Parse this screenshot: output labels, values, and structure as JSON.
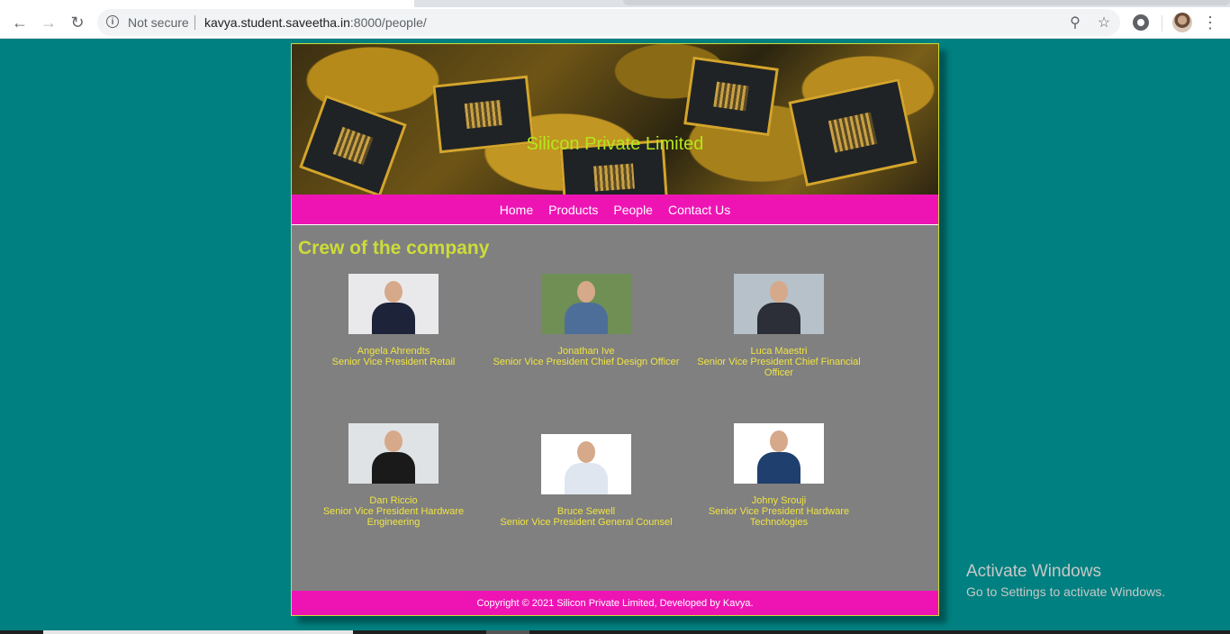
{
  "browser": {
    "security_label": "Not secure",
    "url_host": "kavya.student.saveetha.in",
    "url_rest": ":8000/people/"
  },
  "site": {
    "company_name": "Silicon Private Limited",
    "nav": [
      "Home",
      "Products",
      "People",
      "Contact Us"
    ],
    "heading": "Crew of the company",
    "people": [
      {
        "name": "Angela Ahrendts",
        "title": "Senior Vice President Retail",
        "suit_color": "#1d2338",
        "bg_color": "#e9e9ec"
      },
      {
        "name": "Jonathan Ive",
        "title": "Senior Vice President Chief Design Officer",
        "suit_color": "#4e6e9a",
        "bg_color": "#6f8f55"
      },
      {
        "name": "Luca Maestri",
        "title": "Senior Vice President Chief Financial Officer",
        "suit_color": "#2c2f38",
        "bg_color": "#b7c1c9"
      },
      {
        "name": "Dan Riccio",
        "title": "Senior Vice President Hardware Engineering",
        "suit_color": "#1a1a1a",
        "bg_color": "#dfe3e6"
      },
      {
        "name": "Bruce Sewell",
        "title": "Senior Vice President General Counsel",
        "suit_color": "#dfe6f0",
        "bg_color": "#ffffff"
      },
      {
        "name": "Johny Srouji",
        "title": "Senior Vice President Hardware Technologies",
        "suit_color": "#1f3f6e",
        "bg_color": "#ffffff"
      }
    ],
    "footer": "Copyright © 2021 Silicon Private Limited, Developed by Kavya."
  },
  "os": {
    "activate_title": "Activate Windows",
    "activate_sub": "Go to Settings to activate Windows."
  },
  "icons": [
    "back-arrow-icon",
    "forward-arrow-icon",
    "reload-icon",
    "info-icon",
    "zoom-icon",
    "star-icon",
    "extension-icon",
    "profile-avatar",
    "menu-dots-icon"
  ]
}
